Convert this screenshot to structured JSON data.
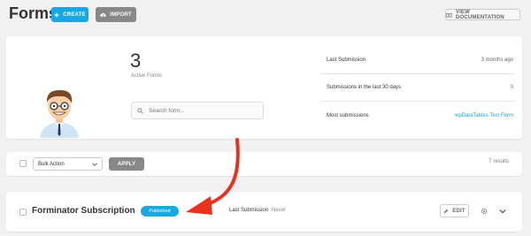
{
  "header": {
    "title": "Forms",
    "create_label": "CREATE",
    "import_label": "IMPORT",
    "docs_label": "VIEW DOCUMENTATION"
  },
  "summary": {
    "count": "3",
    "count_label": "Active Forms",
    "search_placeholder": "Search form...",
    "stats": [
      {
        "label": "Last Submission",
        "value": "3 months ago"
      },
      {
        "label": "Submissions in the last 30 days",
        "value": "0"
      },
      {
        "label": "Most submissions",
        "value": "wpDataTables Test Form"
      }
    ]
  },
  "bulk": {
    "select_value": "Bulk Action",
    "apply_label": "APPLY",
    "results": "7 results"
  },
  "form_row": {
    "name": "Forminator Subscription",
    "status": "Published",
    "last_submission_label": "Last Submission",
    "last_submission_value": "Never",
    "edit_label": "EDIT"
  },
  "colors": {
    "accent": "#17a8e3",
    "gray_button": "#888888",
    "annotation_arrow": "#e8321e"
  }
}
